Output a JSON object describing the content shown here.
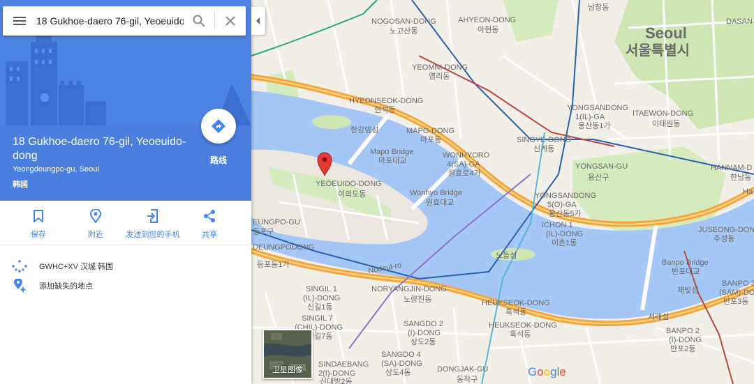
{
  "search": {
    "value": "18 Gukhoe-daero 76-gil, Yeoeuido-dong",
    "menu_icon": "hamburger-icon",
    "search_icon": "search-icon",
    "close_icon": "close-icon"
  },
  "place": {
    "title": "18 Gukhoe-daero 76-gil, Yeoeuido-dong",
    "subtitle": "Yeongdeungpo-gu, Seoul",
    "country": "韩国",
    "directions_label": "路线"
  },
  "actions": [
    {
      "label": "保存",
      "icon": "bookmark-icon"
    },
    {
      "label": "附近",
      "icon": "nearby-pin-icon"
    },
    {
      "label": "发送到您的手机",
      "icon": "send-to-phone-icon"
    },
    {
      "label": "共享",
      "icon": "share-icon"
    }
  ],
  "info": {
    "plus_code": "GWHC+XV 汉城 韩国",
    "add_missing": "添加缺失的地点"
  },
  "map": {
    "labels": {
      "seoul_en": "Seoul",
      "seoul_ko": "서울특별시",
      "nogosan_en": "NOGOSAN-DONG",
      "nogosan_ko": "노고산동",
      "ahyeon_en": "AHYEON-DONG",
      "ahyeon_ko": "아현동",
      "dasan_en": "DASAN-",
      "namsan_ko": "남창동",
      "yeomni_en": "YEOMNI-DONG",
      "yeomni_ko": "염리동",
      "hyeonseok_en": "HYEONSEOK-DONG",
      "hyeonseok_ko": "현석동",
      "hangang_ko": "한강밤섬",
      "mapo_en": "MAPO-DONG",
      "mapo_ko": "마포동",
      "mapo_bridge_en": "Mapo Bridge",
      "mapo_bridge_ko": "마포대교",
      "wonhyoro_en": "WONHYORO",
      "wonhyoro_en2": "4(SA)-GA",
      "wonhyoro_ko": "원효로4가",
      "yongsan1_en": "YONGSANDONG",
      "yongsan1_en2": "1(IL)-GA",
      "yongsan1_ko": "용산동1가",
      "itaewon_en": "ITAEWON-DONG",
      "itaewon_ko": "이태원동",
      "singye_en": "SINGYE-DONG",
      "singye_ko": "신계동",
      "yongsangu_en": "YONGSAN-GU",
      "yongsangu_ko": "용산구",
      "hannam_en": "HANNAM-D",
      "hannam_ko": "한남동",
      "ha": "Ha",
      "yeoeuido_en": "YEOEUIDO-DONG",
      "yeoeuido_ko": "여의도동",
      "wonhyo_bridge_en": "Wonhyo Bridge",
      "wonhyo_bridge_ko": "원효대교",
      "yongsan5_en": "YONGSANDONG",
      "yongsan5_en2": "5(O)-GA",
      "yongsan5_ko": "용산동5가",
      "ichon_en": "ICHON 1",
      "ichon_en2": "(IL)-DONG",
      "ichon_ko": "이촌1동",
      "jugseong_en": "JUSEONG-DONG",
      "jugseong_ko": "주성동",
      "deungpo_en": "EUNGPO-GU",
      "deungpo_ko": "등포구",
      "nodeul_ko": "노들섬",
      "banpo_bridge_en": "Banpo Bridge",
      "banpo_bridge_ko": "반포대교",
      "chaebit_ko": "채빛섬",
      "deungpodong_en": "DEUNGPODONG",
      "deungpodong_ko": "등포동1가",
      "nodeul_ro": "Nodeul-ro",
      "singil1_en": "SINGIL 1",
      "singil1_en2": "(IL)-DONG",
      "singil1_ko": "신길1동",
      "noryangjin_en": "NORYANGJIN-DONG",
      "noryangjin_ko": "노량진동",
      "heukseok_en": "HEUKSEOK-DONG",
      "heukseok_ko": "흑석동",
      "banpo3_en": "BANPO 3",
      "banpo3_en2": "(SAM)-DO",
      "banpo3_ko": "반포3동",
      "seorae_ko": "서래섬",
      "singil7_en": "SINGIL 7",
      "singil7_en2": "(CHIL)-DONG",
      "singil7_ko": "신길7동",
      "sangdo2_en": "SANGDO 2",
      "sangdo2_en2": "(I)-DONG",
      "sangdo2_ko": "상도2동",
      "heukseok2_en": "HEUKSEOK-DONG",
      "heukseok2_ko": "흑석동",
      "banpo2_en": "BANPO 2",
      "banpo2_en2": "(I)-DONG",
      "banpo2_ko": "반포2동",
      "sindaebang_en": "SINDAEBANG",
      "sindaebang_en2": "2(I)-DONG",
      "sindaebang_ko": "신대방2동",
      "sangdo4_en": "SANGDO 4",
      "sangdo4_en2": "(SA)-DONG",
      "sangdo4_ko": "상도4동",
      "dongjak_en": "DONGJAK-GU",
      "dongjak_ko": "동작구"
    },
    "satellite_label": "卫星图像",
    "logo": "Google",
    "colors": {
      "water": "#a4c7f5",
      "land": "#f2efe9",
      "park": "#cfe6b4",
      "highway": "#f7a43b",
      "accent": "#4a7fe0",
      "pin": "#e53935"
    }
  }
}
